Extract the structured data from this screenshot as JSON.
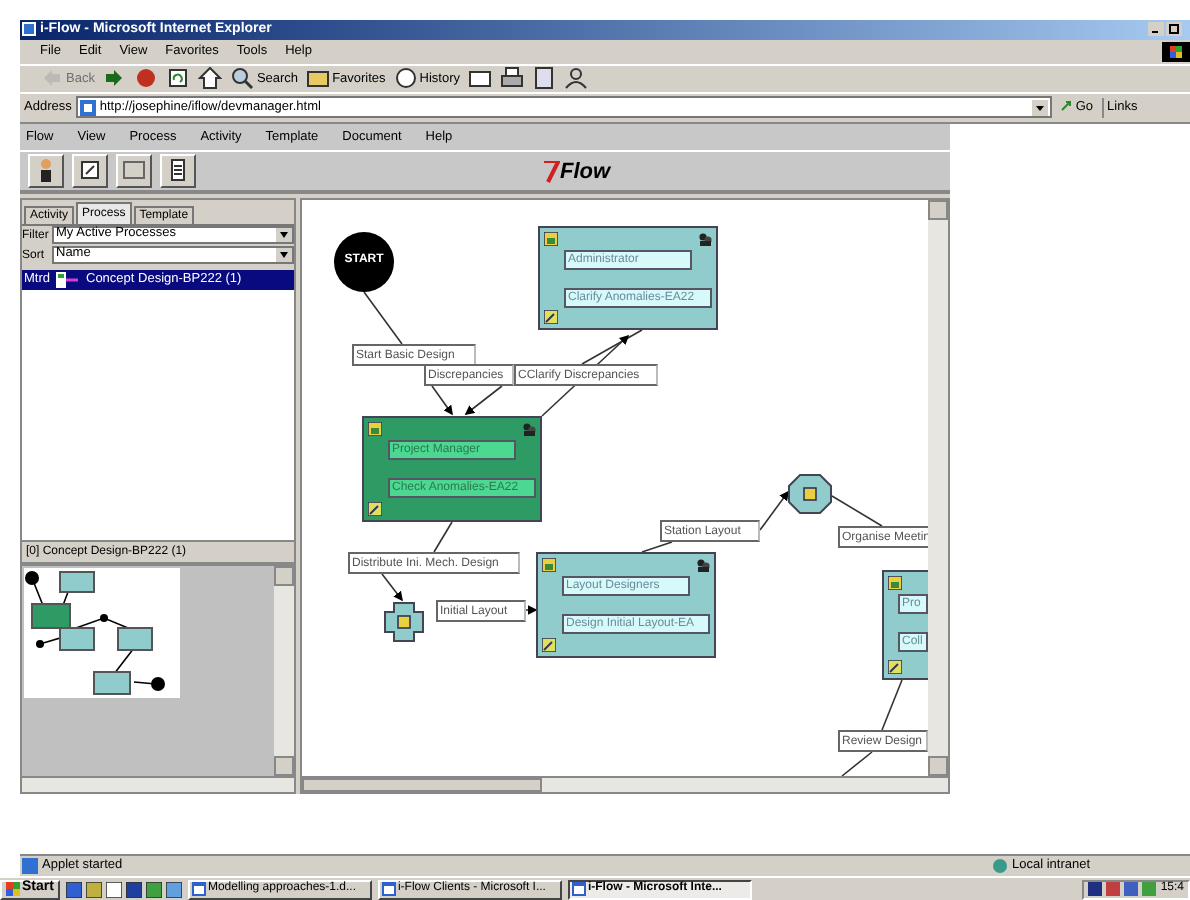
{
  "window": {
    "title": "i-Flow - Microsoft Internet Explorer"
  },
  "browser_menu": [
    "File",
    "Edit",
    "View",
    "Favorites",
    "Tools",
    "Help"
  ],
  "browser_toolbar": [
    {
      "kind": "back",
      "label": "Back",
      "disabled": true
    },
    {
      "kind": "forward",
      "disabled": false
    },
    {
      "kind": "stop",
      "disabled": false
    },
    {
      "kind": "refresh",
      "disabled": false
    },
    {
      "kind": "home",
      "disabled": false
    },
    {
      "kind": "search",
      "label": "Search",
      "disabled": false
    },
    {
      "kind": "favorites",
      "label": "Favorites",
      "disabled": false
    },
    {
      "kind": "history",
      "label": "History",
      "disabled": false
    },
    {
      "kind": "mail",
      "disabled": false
    },
    {
      "kind": "print",
      "disabled": false
    },
    {
      "kind": "edit",
      "disabled": false
    },
    {
      "kind": "discuss",
      "disabled": false
    }
  ],
  "address": {
    "label": "Address",
    "url": "http://josephine/iflow/devmanager.html",
    "go": "Go",
    "links": "Links"
  },
  "app_menu": [
    "Flow",
    "View",
    "Process",
    "Activity",
    "Template",
    "Document",
    "Help"
  ],
  "app_toolbar": [
    {
      "kind": "user"
    },
    {
      "kind": "open"
    },
    {
      "kind": "blank"
    },
    {
      "kind": "list"
    }
  ],
  "logo": "Flow",
  "panel_tabs": [
    {
      "label": "Activity",
      "selected": false
    },
    {
      "label": "Process",
      "selected": true
    },
    {
      "label": "Template",
      "selected": false
    }
  ],
  "filter": {
    "label": "Filter",
    "value": "My Active Processes"
  },
  "sort": {
    "label": "Sort",
    "value": "Name"
  },
  "processes": [
    {
      "column_1": "Mtrd",
      "name": "Concept Design-BP222 (1)",
      "selected": true
    }
  ],
  "panel_status": "[0] Concept Design-BP222 (1)",
  "diagram": {
    "nodes": [
      {
        "kind": "start",
        "label": "START"
      },
      {
        "kind": "activity",
        "role": "Administrator",
        "task": "Clarify Anomalies-EA22",
        "active": false
      },
      {
        "kind": "activity",
        "role": "Project Manager",
        "task": "Check Anomalies-EA22",
        "active": true
      },
      {
        "kind": "decision"
      },
      {
        "kind": "split"
      },
      {
        "kind": "activity",
        "role": "Layout Designers",
        "task": "Design Initial Layout-EA",
        "active": false
      },
      {
        "kind": "activity",
        "role": "Pro",
        "task": "Coll",
        "active": false
      }
    ],
    "labels": [
      "Start Basic Design",
      "Discrepancies",
      "CClarify Discrepancies",
      "Station Layout",
      "Organise Meetin",
      "Distribute Ini. Mech. Design",
      "Initial Layout",
      "Review Design"
    ]
  },
  "status_bar": {
    "text": "Applet started",
    "zone": "Local intranet"
  },
  "taskbar": {
    "start": "Start",
    "tasks": [
      {
        "label": "Modelling approaches-1.d...",
        "selected": false
      },
      {
        "label": "i-Flow Clients - Microsoft I...",
        "selected": false
      },
      {
        "label": "i-Flow - Microsoft Inte...",
        "selected": true
      }
    ],
    "clock": "15:4"
  }
}
